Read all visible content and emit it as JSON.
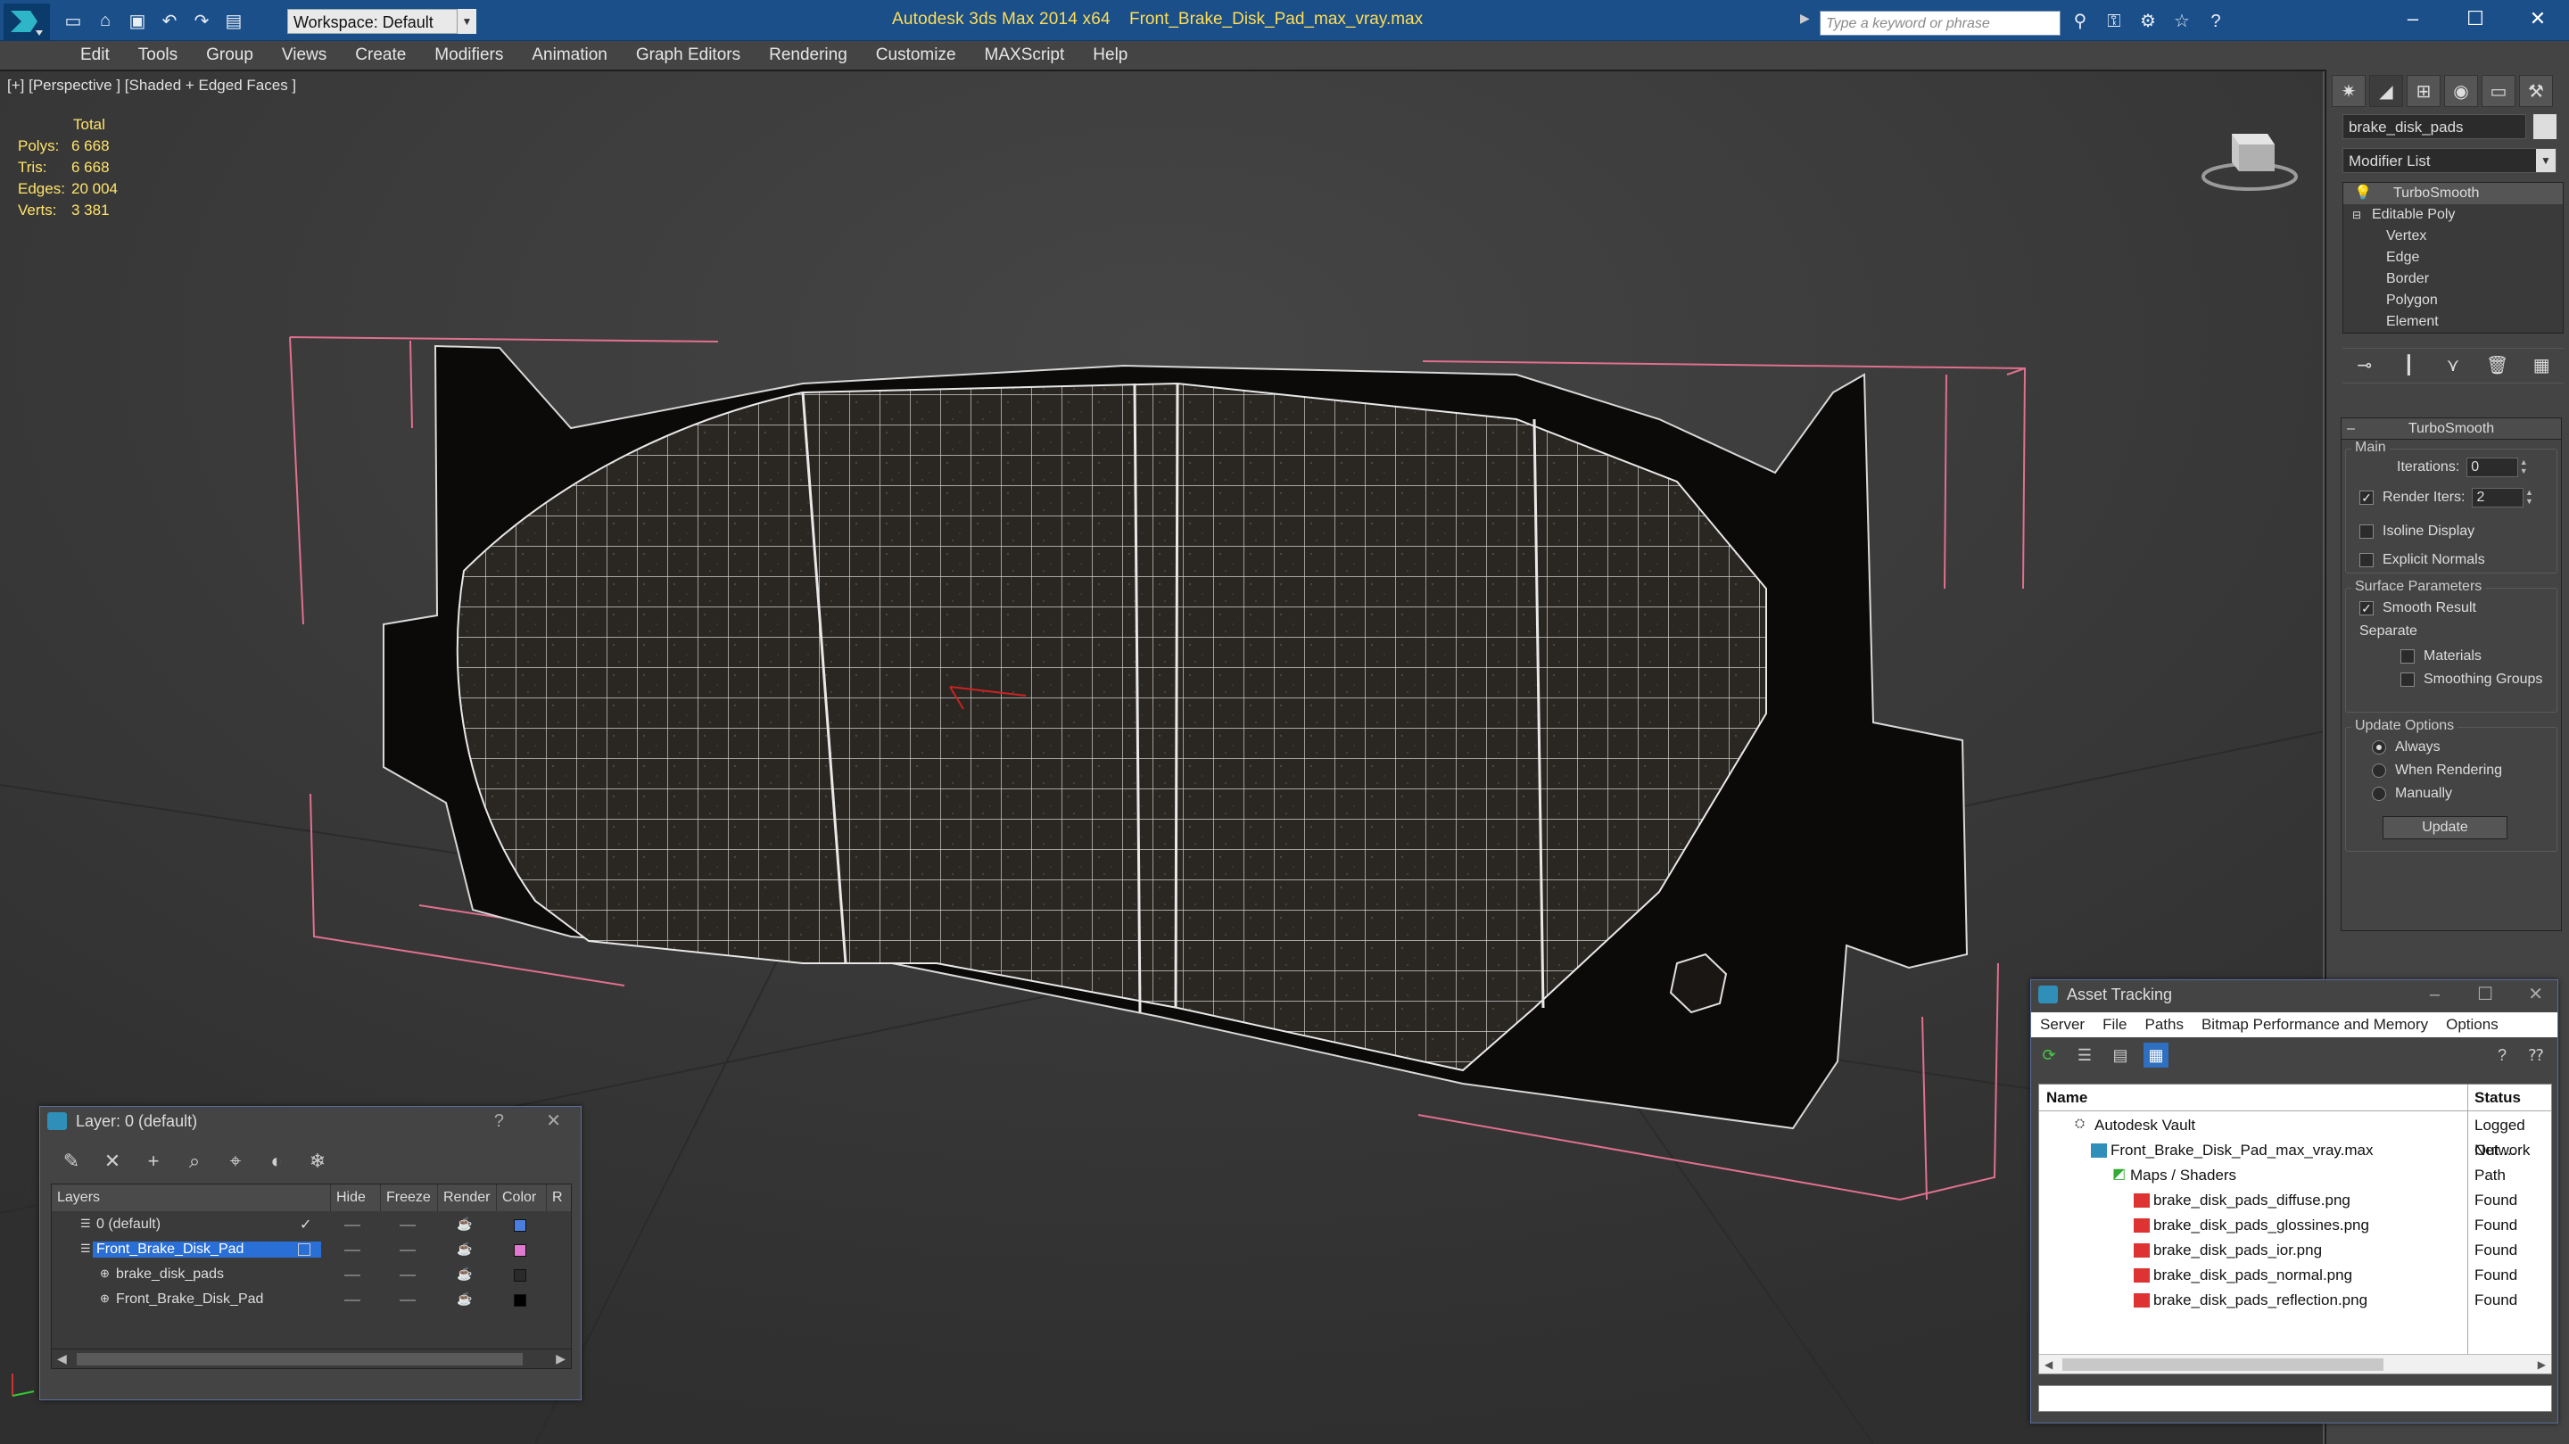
{
  "titlebar": {
    "workspace": "Workspace: Default",
    "app_title": "Autodesk 3ds Max  2014 x64",
    "file_title": "Front_Brake_Disk_Pad_max_vray.max",
    "search_placeholder": "Type a keyword or phrase"
  },
  "menu": [
    "Edit",
    "Tools",
    "Group",
    "Views",
    "Create",
    "Modifiers",
    "Animation",
    "Graph Editors",
    "Rendering",
    "Customize",
    "MAXScript",
    "Help"
  ],
  "viewport": {
    "label": "[+] [Perspective ] [Shaded + Edged Faces ]",
    "stats": {
      "header": "Total",
      "rows": [
        {
          "key": "Polys:",
          "value": "6 668"
        },
        {
          "key": "Tris:",
          "value": "6 668"
        },
        {
          "key": "Edges:",
          "value": "20 004"
        },
        {
          "key": "Verts:",
          "value": "3 381"
        }
      ]
    }
  },
  "command_panel": {
    "object_name": "brake_disk_pads",
    "modifier_list": "Modifier List",
    "stack": {
      "top": "TurboSmooth",
      "base": "Editable Poly",
      "subobjects": [
        "Vertex",
        "Edge",
        "Border",
        "Polygon",
        "Element"
      ]
    },
    "rollout_title": "TurboSmooth",
    "main_group": "Main",
    "iterations_label": "Iterations:",
    "iterations_value": "0",
    "render_iters_label": "Render Iters:",
    "render_iters_value": "2",
    "isoline_label": "Isoline Display",
    "explicit_normals_label": "Explicit Normals",
    "surface_group": "Surface Parameters",
    "smooth_result_label": "Smooth Result",
    "separate_label": "Separate",
    "materials_label": "Materials",
    "smoothing_groups_label": "Smoothing Groups",
    "update_group": "Update Options",
    "always_label": "Always",
    "when_rendering_label": "When Rendering",
    "manually_label": "Manually",
    "update_button": "Update"
  },
  "layer_window": {
    "title": "Layer: 0 (default)",
    "columns": [
      "Layers",
      "Hide",
      "Freeze",
      "Render",
      "Color",
      "R"
    ],
    "rows": [
      {
        "name": "0 (default)",
        "color": "#4a7fe0"
      },
      {
        "name": "Front_Brake_Disk_Pad",
        "color": "#e07ad0"
      },
      {
        "name": "brake_disk_pads",
        "color": "#2a2a2a"
      },
      {
        "name": "Front_Brake_Disk_Pad",
        "color": "#000000"
      }
    ]
  },
  "asset_window": {
    "title": "Asset Tracking",
    "menu": [
      "Server",
      "File",
      "Paths",
      "Bitmap Performance and Memory",
      "Options"
    ],
    "columns": [
      "Name",
      "Status"
    ],
    "rows": [
      {
        "name": "Autodesk Vault",
        "status": "Logged Out ..."
      },
      {
        "name": "Front_Brake_Disk_Pad_max_vray.max",
        "status": "Network Path"
      },
      {
        "name": "Maps / Shaders",
        "status": ""
      },
      {
        "name": "brake_disk_pads_diffuse.png",
        "status": "Found"
      },
      {
        "name": "brake_disk_pads_glossines.png",
        "status": "Found"
      },
      {
        "name": "brake_disk_pads_ior.png",
        "status": "Found"
      },
      {
        "name": "brake_disk_pads_normal.png",
        "status": "Found"
      },
      {
        "name": "brake_disk_pads_reflection.png",
        "status": "Found"
      }
    ]
  },
  "colors": {
    "titlebar": "#1a4f8a",
    "title_text": "#ffdd55",
    "stats_text": "#ffe36a",
    "bbox_pink": "#e0708e",
    "selection_blue": "#2a6fd6"
  }
}
